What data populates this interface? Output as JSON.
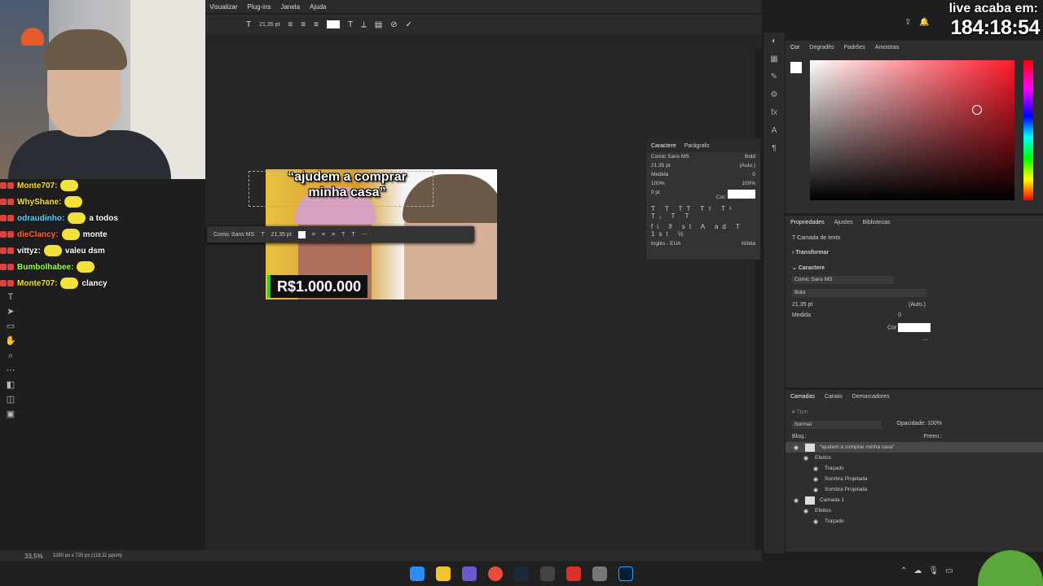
{
  "menu": {
    "items": [
      "Visualizar",
      "Plug-ins",
      "Janela",
      "Ajuda"
    ]
  },
  "options_bar": {
    "font_size": "21,35 pt"
  },
  "live": {
    "label": "live acaba em:",
    "timer": "184:18:54"
  },
  "chat": {
    "messages": [
      {
        "user": "Monte707:",
        "text": "",
        "color": "#f2e23a"
      },
      {
        "user": "WhyShane:",
        "text": "",
        "color": "#f2e23a"
      },
      {
        "user": "odraudinho:",
        "text": "a todos",
        "color": "#5fd0ff"
      },
      {
        "user": "dieClancy:",
        "text": "monte",
        "color": "#ff6a3a"
      },
      {
        "user": "vittyz:",
        "text": "valeu dsm",
        "color": "#ffffff"
      },
      {
        "user": "Bumbolhabee:",
        "text": "",
        "color": "#9cff5a"
      },
      {
        "user": "Monte707:",
        "text": "clancy",
        "color": "#f2e23a"
      }
    ]
  },
  "thumbnail": {
    "title_line1": "“ajudem a comprar",
    "title_line2": "minha casa”",
    "price": "R$1.000.000"
  },
  "context_bar": {
    "font": "Comic Sans MS",
    "size": "21,35 pt"
  },
  "char_panel": {
    "tabs": [
      "Caractere",
      "Parágrafo"
    ],
    "font": "Comic Sans MS",
    "style": "Bold",
    "size": "21,35 pt",
    "leading": "(Auto.)",
    "kerning": "Medida",
    "tracking": "0",
    "vscale": "100%",
    "hscale": "100%",
    "baseline": "0 pt",
    "color_label": "Cor:",
    "language": "Inglês - EUA",
    "antialias": "Nítida"
  },
  "color_panel": {
    "tabs": [
      "Cor",
      "Degradês",
      "Padrões",
      "Amostras"
    ]
  },
  "props_panel": {
    "tabs": [
      "Propriedades",
      "Ajustes",
      "Bibliotecas"
    ],
    "layer_type": "Camada de texto",
    "transform": "Transformar",
    "caractere": "Caractere",
    "font": "Comic Sans MS",
    "style": "Bold",
    "size": "21,35 pt",
    "leading": "(Auto.)",
    "kerning": "Medida",
    "tracking": "0",
    "color_label": "Cor"
  },
  "layers_panel": {
    "tabs": [
      "Camadas",
      "Canais",
      "Demarcadores"
    ],
    "search": "Tipo",
    "blend": "Normal",
    "opacity_label": "Opacidade:",
    "opacity": "100%",
    "lock_label": "Bloq.:",
    "fill_label": "Preen.:",
    "layers": [
      {
        "name": "“ajudem a comprar minha casa”",
        "selected": true,
        "indent": 0
      },
      {
        "name": "Efeitos",
        "selected": false,
        "indent": 1
      },
      {
        "name": "Traçado",
        "selected": false,
        "indent": 2
      },
      {
        "name": "Sombra Projetada",
        "selected": false,
        "indent": 2
      },
      {
        "name": "Sombra Projetada",
        "selected": false,
        "indent": 2
      },
      {
        "name": "Camada 1",
        "selected": false,
        "indent": 0
      },
      {
        "name": "Efeitos",
        "selected": false,
        "indent": 1
      },
      {
        "name": "Traçado",
        "selected": false,
        "indent": 2
      }
    ]
  },
  "status": {
    "zoom": "33,5%",
    "doc_info": "1280 px x 720 px (118,11 ppcm)"
  }
}
